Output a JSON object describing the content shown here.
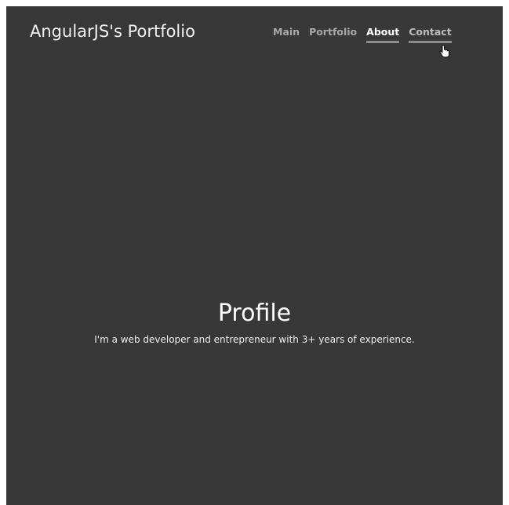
{
  "header": {
    "brand": "AngularJS's Portfolio",
    "nav": [
      {
        "label": "Main",
        "state": "default"
      },
      {
        "label": "Portfolio",
        "state": "default"
      },
      {
        "label": "About",
        "state": "active"
      },
      {
        "label": "Contact",
        "state": "hover"
      }
    ]
  },
  "hero": {
    "title": "Profile",
    "subtitle": "I'm a web developer and entrepreneur with 3+ years of experience."
  },
  "colors": {
    "background": "#383838",
    "text": "#ffffff",
    "nav_muted": "#a9a9a9",
    "underline": "#8c8c8c"
  },
  "icons": {
    "cursor": "hand-pointer-icon"
  }
}
